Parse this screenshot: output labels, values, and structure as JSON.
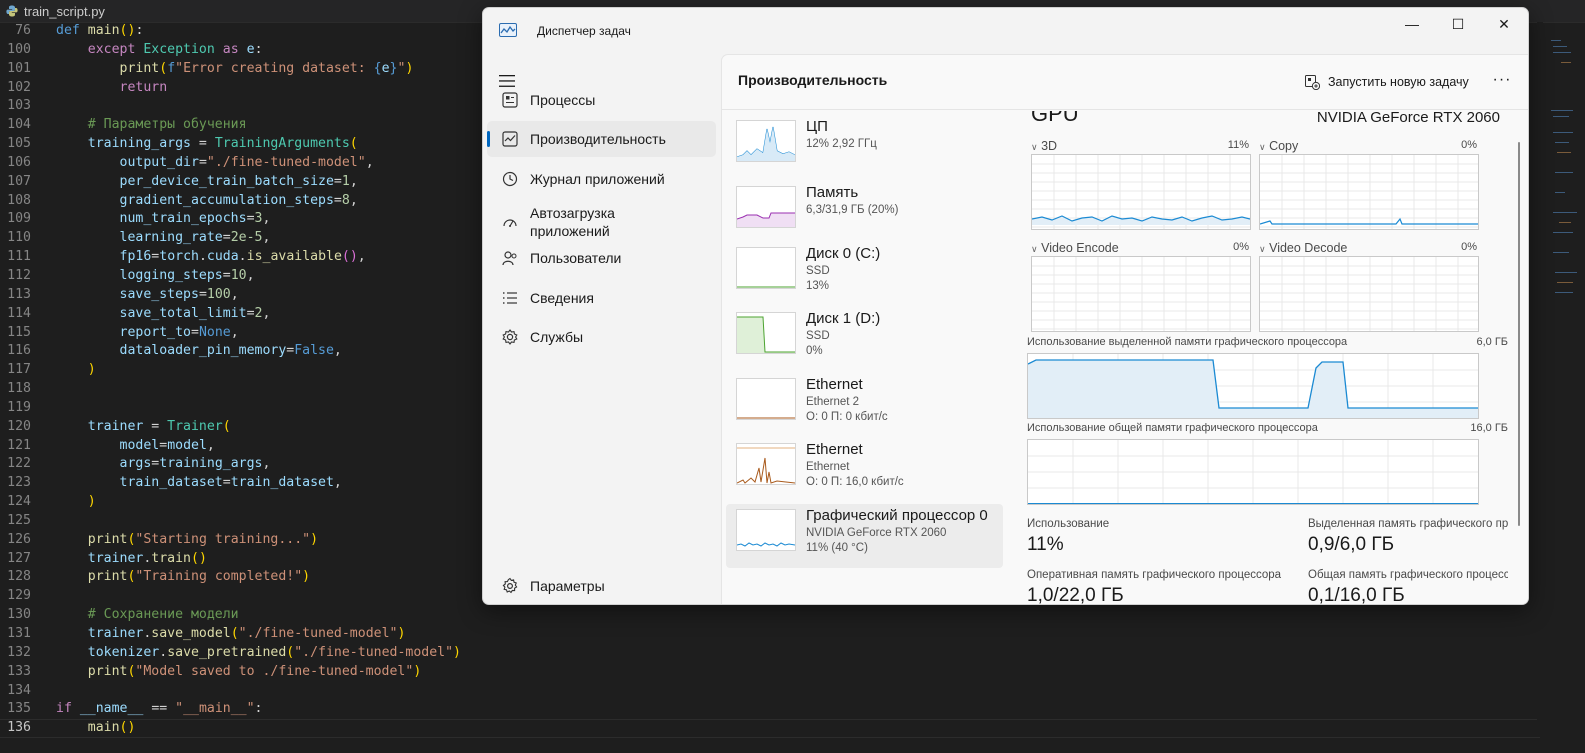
{
  "editor": {
    "tab_title": "train_script.py",
    "lines": [
      {
        "n": "76",
        "html": "<span class='kb'>def</span> <span class='fn'>main</span><span class='br1'>()</span>:"
      },
      {
        "n": "100",
        "html": "    <span class='kw'>except</span> <span class='cls'>Exception</span> <span class='kw'>as</span> <span class='var'>e</span>:"
      },
      {
        "n": "101",
        "html": "        <span class='fn'>print</span><span class='br1'>(</span><span class='kb'>f</span><span class='str'>\"Error creating dataset: </span><span class='kb'>{</span><span class='var'>e</span><span class='kb'>}</span><span class='str'>\"</span><span class='br1'>)</span>"
      },
      {
        "n": "102",
        "html": "        <span class='kw'>return</span>"
      },
      {
        "n": "103",
        "html": ""
      },
      {
        "n": "104",
        "html": "    <span class='cm'># Параметры обучения</span>"
      },
      {
        "n": "105",
        "html": "    <span class='var'>training_args</span> = <span class='cls'>TrainingArguments</span><span class='br1'>(</span>"
      },
      {
        "n": "106",
        "html": "        <span class='var'>output_dir</span>=<span class='str'>\"./fine-tuned-model\"</span>,"
      },
      {
        "n": "107",
        "html": "        <span class='var'>per_device_train_batch_size</span>=<span class='num2'>1</span>,"
      },
      {
        "n": "108",
        "html": "        <span class='var'>gradient_accumulation_steps</span>=<span class='num2'>8</span>,"
      },
      {
        "n": "109",
        "html": "        <span class='var'>num_train_epochs</span>=<span class='num2'>3</span>,"
      },
      {
        "n": "110",
        "html": "        <span class='var'>learning_rate</span>=<span class='num2'>2e-5</span>,"
      },
      {
        "n": "111",
        "html": "        <span class='var'>fp16</span>=<span class='var'>torch</span>.<span class='var'>cuda</span>.<span class='fn'>is_available</span><span class='br2'>()</span>,"
      },
      {
        "n": "112",
        "html": "        <span class='var'>logging_steps</span>=<span class='num2'>10</span>,"
      },
      {
        "n": "113",
        "html": "        <span class='var'>save_steps</span>=<span class='num2'>100</span>,"
      },
      {
        "n": "114",
        "html": "        <span class='var'>save_total_limit</span>=<span class='num2'>2</span>,"
      },
      {
        "n": "115",
        "html": "        <span class='var'>report_to</span>=<span class='kb'>None</span>,"
      },
      {
        "n": "116",
        "html": "        <span class='var'>dataloader_pin_memory</span>=<span class='kb'>False</span>,"
      },
      {
        "n": "117",
        "html": "    <span class='br1'>)</span>"
      },
      {
        "n": "118",
        "html": ""
      },
      {
        "n": "119",
        "html": ""
      },
      {
        "n": "120",
        "html": "    <span class='var'>trainer</span> = <span class='cls'>Trainer</span><span class='br1'>(</span>"
      },
      {
        "n": "121",
        "html": "        <span class='var'>model</span>=<span class='var'>model</span>,"
      },
      {
        "n": "122",
        "html": "        <span class='var'>args</span>=<span class='var'>training_args</span>,"
      },
      {
        "n": "123",
        "html": "        <span class='var'>train_dataset</span>=<span class='var'>train_dataset</span>,"
      },
      {
        "n": "124",
        "html": "    <span class='br1'>)</span>"
      },
      {
        "n": "125",
        "html": ""
      },
      {
        "n": "126",
        "html": "    <span class='fn'>print</span><span class='br1'>(</span><span class='str'>\"Starting training...\"</span><span class='br1'>)</span>"
      },
      {
        "n": "127",
        "html": "    <span class='var'>trainer</span>.<span class='fn'>train</span><span class='br1'>()</span>"
      },
      {
        "n": "128",
        "html": "    <span class='fn'>print</span><span class='br1'>(</span><span class='str'>\"Training completed!\"</span><span class='br1'>)</span>"
      },
      {
        "n": "129",
        "html": ""
      },
      {
        "n": "130",
        "html": "    <span class='cm'># Сохранение модели</span>"
      },
      {
        "n": "131",
        "html": "    <span class='var'>trainer</span>.<span class='fn'>save_model</span><span class='br1'>(</span><span class='str'>\"./fine-tuned-model\"</span><span class='br1'>)</span>"
      },
      {
        "n": "132",
        "html": "    <span class='var'>tokenizer</span>.<span class='fn'>save_pretrained</span><span class='br1'>(</span><span class='str'>\"./fine-tuned-model\"</span><span class='br1'>)</span>"
      },
      {
        "n": "133",
        "html": "    <span class='fn'>print</span><span class='br1'>(</span><span class='str'>\"Model saved to ./fine-tuned-model\"</span><span class='br1'>)</span>"
      },
      {
        "n": "134",
        "html": ""
      },
      {
        "n": "135",
        "html": "<span class='kw'>if</span> <span class='var'>__name__</span> == <span class='str'>\"__main__\"</span>:"
      },
      {
        "n": "136",
        "html": "    <span class='fn'>main</span><span class='br1'>()</span>",
        "current": true
      }
    ]
  },
  "taskmanager": {
    "title": "Диспетчер задач",
    "window_buttons": {
      "minimize": "—",
      "maximize": "☐",
      "close": "✕"
    },
    "nav": [
      {
        "id": "processes",
        "label": "Процессы",
        "icon": "processes-icon"
      },
      {
        "id": "performance",
        "label": "Производительность",
        "icon": "performance-icon",
        "active": true
      },
      {
        "id": "app-history",
        "label": "Журнал приложений",
        "icon": "history-icon"
      },
      {
        "id": "startup",
        "label": "Автозагрузка приложений",
        "icon": "startup-icon"
      },
      {
        "id": "users",
        "label": "Пользователи",
        "icon": "users-icon"
      },
      {
        "id": "details",
        "label": "Сведения",
        "icon": "details-icon"
      },
      {
        "id": "services",
        "label": "Службы",
        "icon": "services-icon"
      }
    ],
    "settings_label": "Параметры",
    "page_title": "Производительность",
    "run_task_label": "Запустить новую задачу",
    "more_label": "···",
    "devices": [
      {
        "name": "ЦП",
        "sub1": "12%  2,92 ГГц",
        "sub2": "",
        "color": "#1b8ad3"
      },
      {
        "name": "Память",
        "sub1": "6,3/31,9 ГБ (20%)",
        "sub2": "",
        "color": "#9a2fb0"
      },
      {
        "name": "Диск 0 (C:)",
        "sub1": "SSD",
        "sub2": "13%",
        "color": "#4ca330"
      },
      {
        "name": "Диск 1 (D:)",
        "sub1": "SSD",
        "sub2": "0%",
        "color": "#4ca330"
      },
      {
        "name": "Ethernet",
        "sub1": "Ethernet 2",
        "sub2": "О: 0  П: 0 кбит/с",
        "color": "#a95a1c"
      },
      {
        "name": "Ethernet",
        "sub1": "Ethernet",
        "sub2": "О: 0  П: 16,0 кбит/с",
        "color": "#a95a1c"
      },
      {
        "name": "Графический процессор 0",
        "sub1": "NVIDIA GeForce RTX 2060",
        "sub2": "11% (40 °C)",
        "color": "#1b8ad3",
        "active": true
      }
    ],
    "gpu": {
      "heading": "GPU",
      "model": "NVIDIA GeForce RTX 2060",
      "engines": [
        {
          "label": "3D",
          "value": "11%"
        },
        {
          "label": "Copy",
          "value": "0%"
        },
        {
          "label": "Video Encode",
          "value": "0%"
        },
        {
          "label": "Video Decode",
          "value": "0%"
        }
      ],
      "dedicated_label": "Использование выделенной памяти графического процессора",
      "dedicated_max": "6,0 ГБ",
      "shared_label": "Использование общей памяти графического процессора",
      "shared_max": "16,0 ГБ",
      "stats": [
        {
          "label": "Использование",
          "value": "11%"
        },
        {
          "label": "Выделенная память графического процессора",
          "value": "0,9/6,0 ГБ"
        },
        {
          "label": "Оперативная память графического процессора",
          "value": "1,0/22,0 ГБ"
        },
        {
          "label": "Общая память графического процессора",
          "value": "0,1/16,0 ГБ"
        }
      ]
    },
    "colors": {
      "accent": "#0067c0",
      "graph_line": "#1b8ad3",
      "graph_fill": "#e2eef7"
    }
  }
}
